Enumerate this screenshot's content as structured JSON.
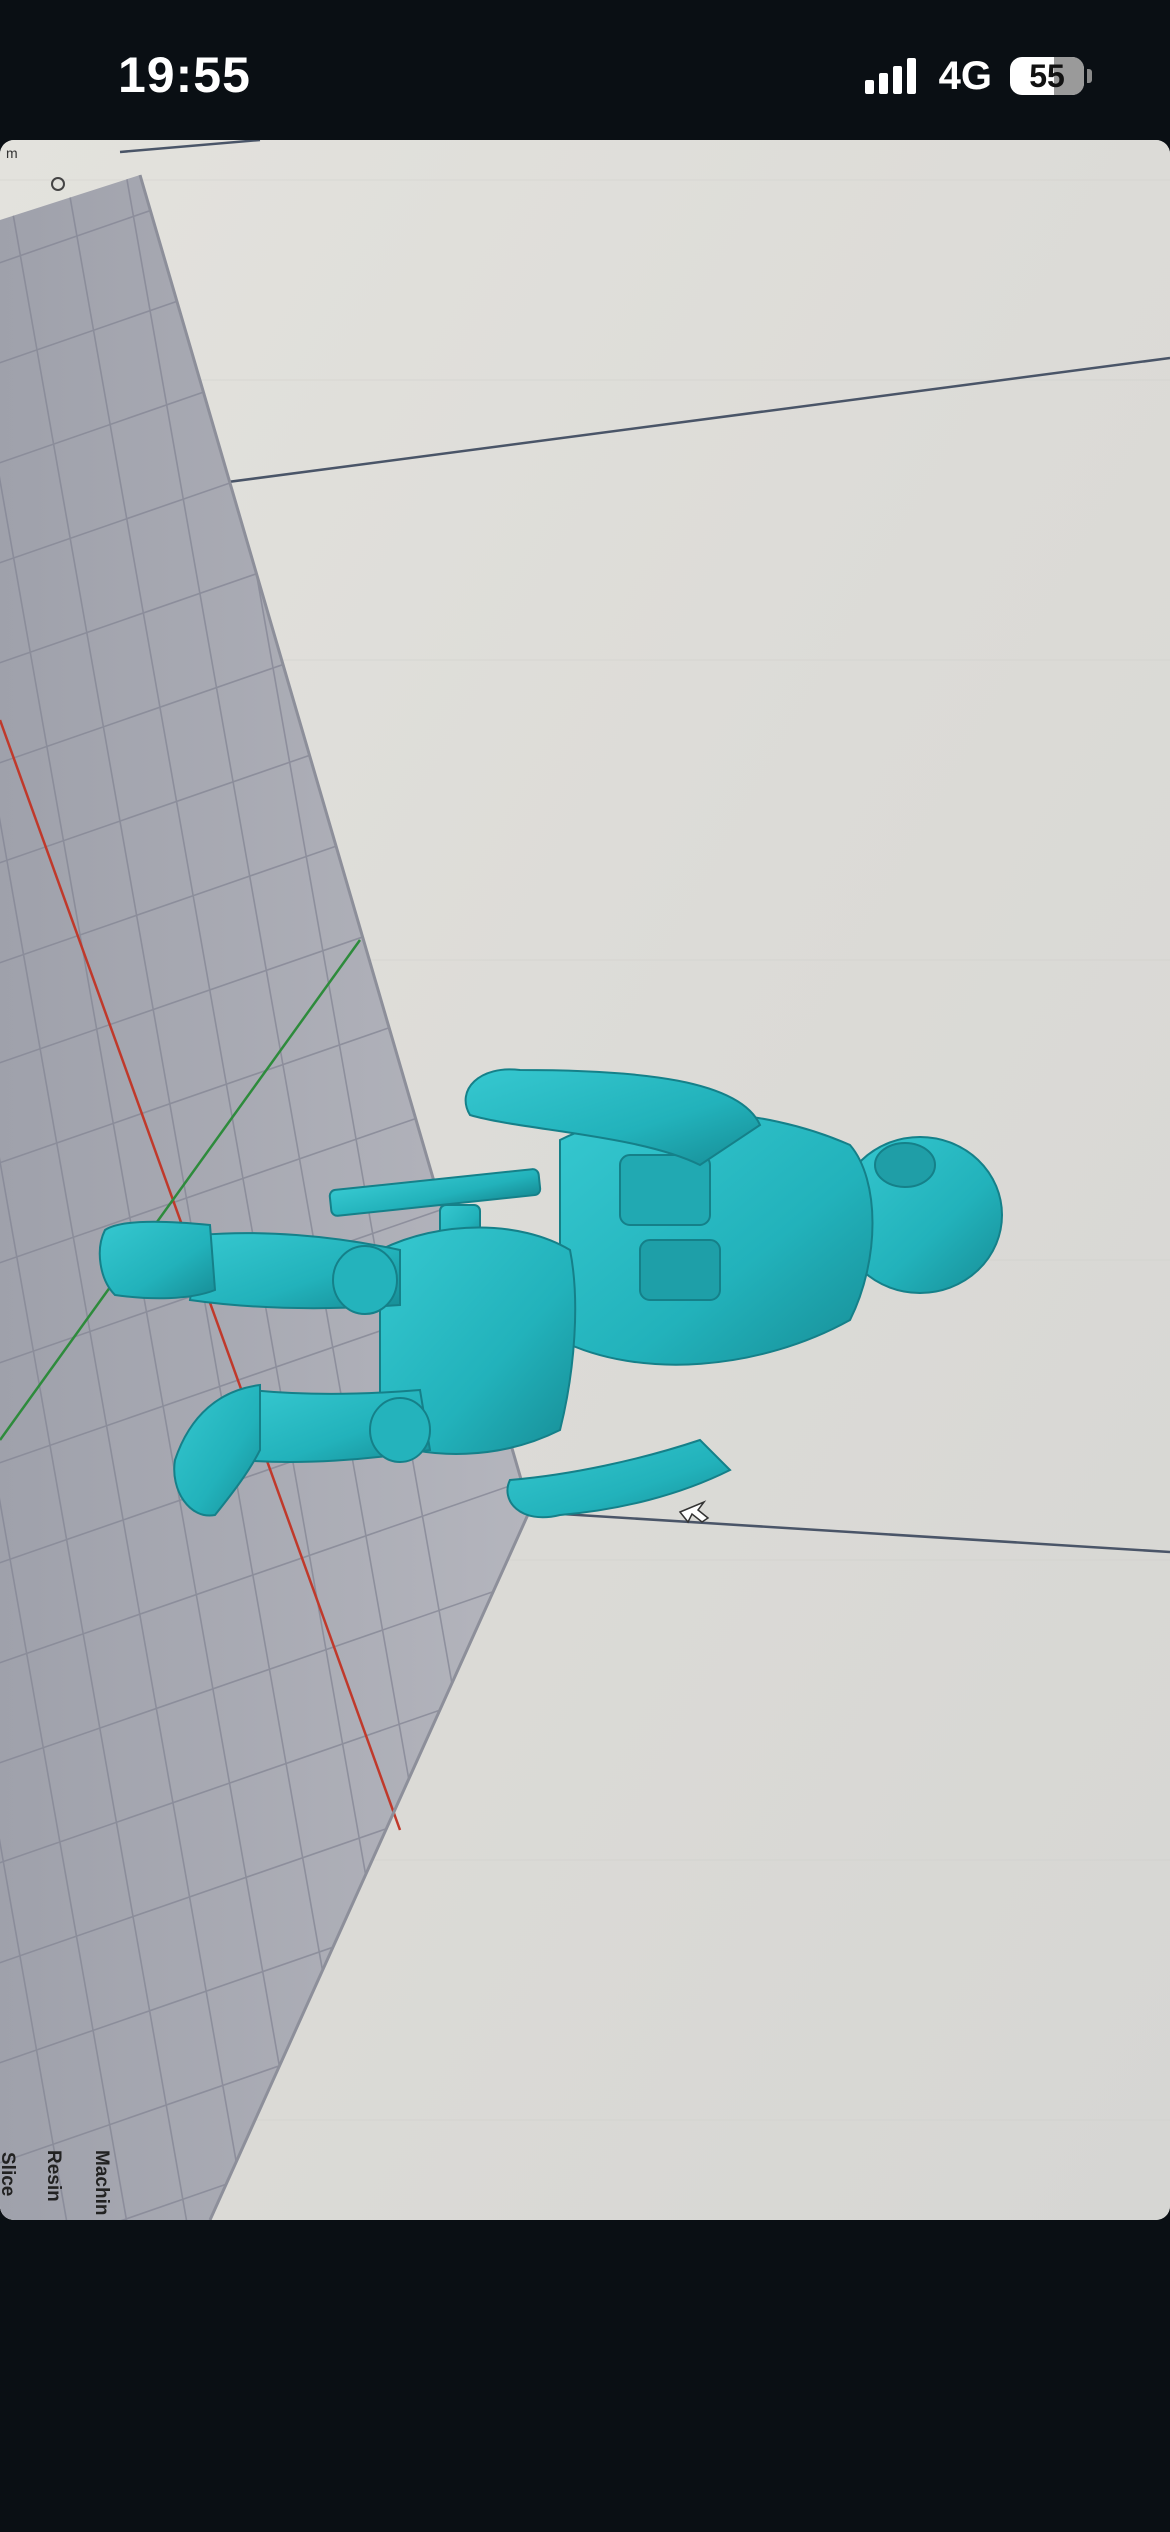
{
  "status_bar": {
    "time": "19:55",
    "network": "4G",
    "battery_level": "55",
    "signal_icon": "cellular-signal-icon",
    "battery_icon": "battery-icon"
  },
  "photo": {
    "subject": "3D printing slicer viewport with teal resin miniature model of a soldier",
    "model_color": "#2bbcc4",
    "build_plate_color": "#a9abb6",
    "background_color": "#dddcd8"
  },
  "slicer_panel": {
    "labels": [
      "Machin",
      "Resin",
      "Slice"
    ]
  }
}
